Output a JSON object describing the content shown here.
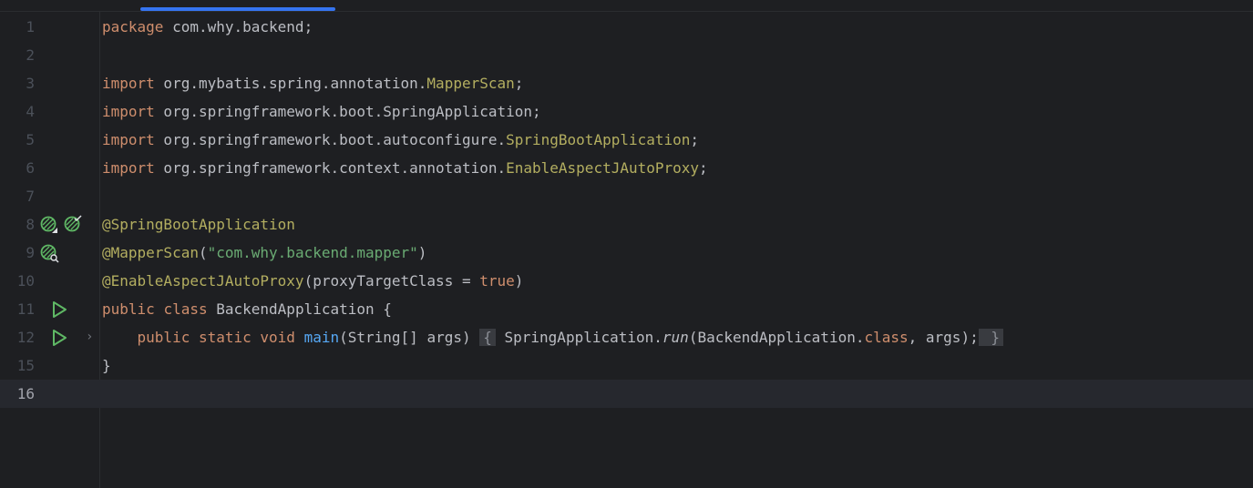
{
  "editor": {
    "lines": [
      {
        "num": "1",
        "segments": [
          {
            "t": "package",
            "c": "kw"
          },
          {
            "t": " com.why.backend;"
          }
        ]
      },
      {
        "num": "2",
        "segments": []
      },
      {
        "num": "3",
        "segments": [
          {
            "t": "import",
            "c": "kw"
          },
          {
            "t": " org.mybatis.spring.annotation."
          },
          {
            "t": "MapperScan",
            "c": "cls"
          },
          {
            "t": ";"
          }
        ]
      },
      {
        "num": "4",
        "segments": [
          {
            "t": "import",
            "c": "kw"
          },
          {
            "t": " org.springframework.boot.SpringApplication;"
          }
        ]
      },
      {
        "num": "5",
        "segments": [
          {
            "t": "import",
            "c": "kw"
          },
          {
            "t": " org.springframework.boot.autoconfigure."
          },
          {
            "t": "SpringBootApplication",
            "c": "cls"
          },
          {
            "t": ";"
          }
        ]
      },
      {
        "num": "6",
        "segments": [
          {
            "t": "import",
            "c": "kw"
          },
          {
            "t": " org.springframework.context.annotation."
          },
          {
            "t": "EnableAspectJAutoProxy",
            "c": "cls"
          },
          {
            "t": ";"
          }
        ]
      },
      {
        "num": "7",
        "segments": []
      },
      {
        "num": "8",
        "segments": [
          {
            "t": "@SpringBootApplication",
            "c": "ann"
          }
        ],
        "gutter": [
          "bean-icon",
          "autowire-check-icon"
        ]
      },
      {
        "num": "9",
        "segments": [
          {
            "t": "@MapperScan",
            "c": "ann"
          },
          {
            "t": "("
          },
          {
            "t": "\"com.why.backend.mapper\"",
            "c": "str"
          },
          {
            "t": ")"
          }
        ],
        "gutter": [
          "bean-search-icon"
        ]
      },
      {
        "num": "10",
        "segments": [
          {
            "t": "@EnableAspectJAutoProxy",
            "c": "ann"
          },
          {
            "t": "(proxyTargetClass = "
          },
          {
            "t": "true",
            "c": "kw"
          },
          {
            "t": ")"
          }
        ]
      },
      {
        "num": "11",
        "segments": [
          {
            "t": "public",
            "c": "kw"
          },
          {
            "t": " "
          },
          {
            "t": "class",
            "c": "kw"
          },
          {
            "t": " BackendApplication {"
          }
        ],
        "gutter": [
          "run-icon"
        ]
      },
      {
        "num": "12",
        "segments": [
          {
            "t": "    "
          },
          {
            "t": "public",
            "c": "kw"
          },
          {
            "t": " "
          },
          {
            "t": "static",
            "c": "kw"
          },
          {
            "t": " "
          },
          {
            "t": "void",
            "c": "kw"
          },
          {
            "t": " "
          },
          {
            "t": "main",
            "c": "fn"
          },
          {
            "t": "(String[] args) "
          },
          {
            "t": "{",
            "c": "fold-box"
          },
          {
            "t": " SpringApplication."
          },
          {
            "t": "run",
            "c": "ital"
          },
          {
            "t": "(BackendApplication."
          },
          {
            "t": "class",
            "c": "kw"
          },
          {
            "t": ", args);"
          },
          {
            "t": " }",
            "c": "fold-box"
          }
        ],
        "gutter": [
          "run-icon"
        ],
        "fold": true
      },
      {
        "num": "15",
        "segments": [
          {
            "t": "}"
          }
        ]
      },
      {
        "num": "16",
        "segments": [],
        "current": true
      }
    ]
  },
  "colors": {
    "background": "#1e1f22",
    "keyword": "#cf8e6d",
    "annotation": "#b3ae60",
    "string": "#6aab73",
    "function": "#56a8f5",
    "text": "#bcbec4",
    "run": "#5fb865",
    "tab_indicator": "#3574f0"
  }
}
